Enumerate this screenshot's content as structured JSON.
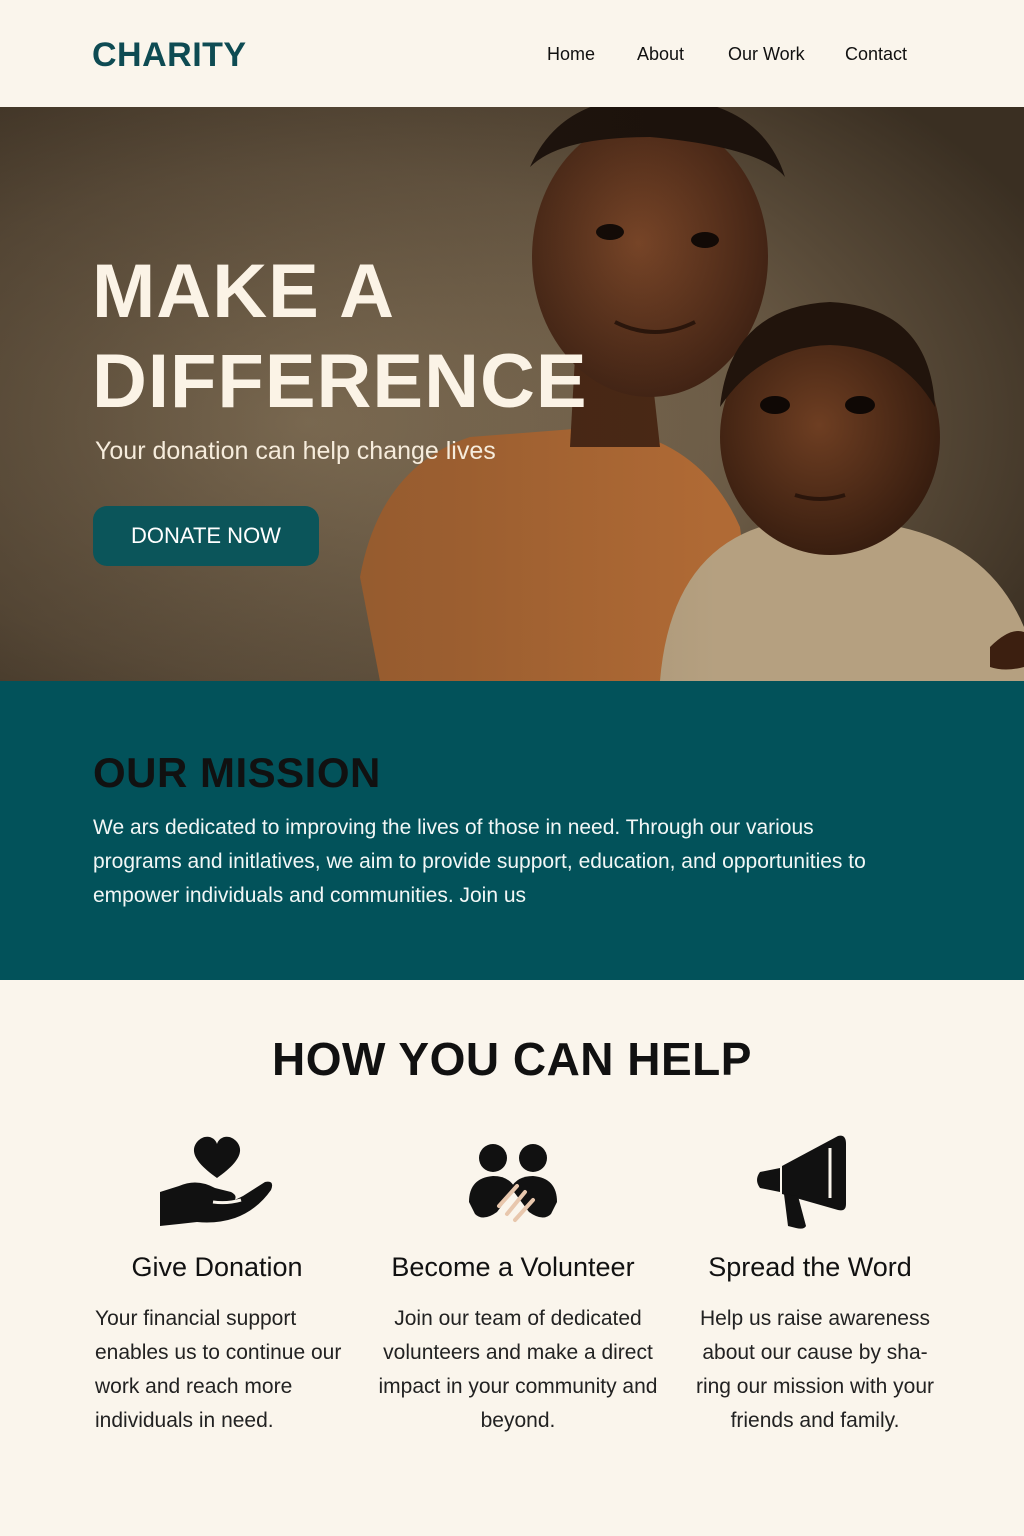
{
  "header": {
    "logo": "CHARITY",
    "nav": [
      "Home",
      "About",
      "Our Work",
      "Contact"
    ]
  },
  "hero": {
    "title_line1": "MAKE A",
    "title_line2": "DIFFERENCE",
    "subtitle": "Your donation can help change lives",
    "button_label": "DONATE NOW"
  },
  "mission": {
    "heading": "OUR MISSION",
    "text": "We ars dedicated to improving the lives of those in need. Through our various programs and initlatives, we aim to provide support, education, and opportunities to empower individuals and communities. Join us"
  },
  "help": {
    "heading": "HOW YOU CAN HELP",
    "cards": [
      {
        "icon": "heart-hand-icon",
        "title": "Give Donation",
        "text": "Your financial support enables us to continue our work and reach more individuals in need."
      },
      {
        "icon": "volunteers-handshake-icon",
        "title": "Become a Volunteer",
        "text": "Join our team of dedicated volunteers and make a direct impact in your community and beyond."
      },
      {
        "icon": "megaphone-icon",
        "title": "Spread the Word",
        "text": "Help us raise awareness about our cause by sha-ring our mission with your friends and family."
      }
    ]
  },
  "colors": {
    "brand": "#0e4b53",
    "mission_bg": "#02525a",
    "button_bg": "#0b555a",
    "page_bg": "#faf5ec"
  }
}
